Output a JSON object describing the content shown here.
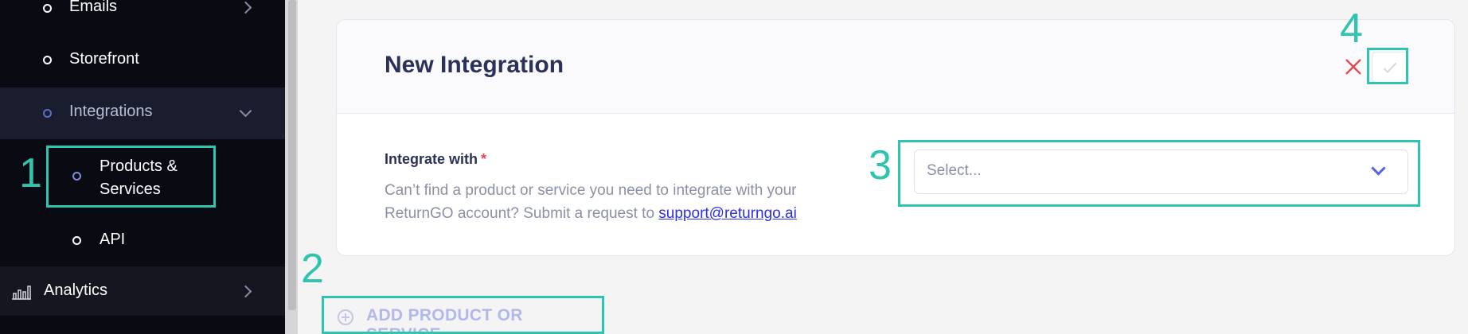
{
  "sidebar": {
    "items": [
      {
        "label": "Emails"
      },
      {
        "label": "Storefront"
      },
      {
        "label": "Integrations"
      },
      {
        "label": "Products & Services"
      },
      {
        "label": "API"
      },
      {
        "label": "Analytics"
      }
    ]
  },
  "card": {
    "title": "New Integration",
    "field_label": "Integrate with",
    "required_mark": "*",
    "help_text": "Can’t find a product or service you need to integrate with your ReturnGO account? Submit a request to ",
    "support_email": "support@returngo.ai",
    "select_placeholder": "Select..."
  },
  "add_button": {
    "label": "ADD PRODUCT OR SERVICE"
  },
  "annotations": [
    "1",
    "2",
    "3",
    "4"
  ],
  "colors": {
    "accent": "#2ec4ad",
    "title": "#2b3159",
    "close": "#e5484d",
    "link": "#2d2fe0",
    "sidebar_bg": "#0a0b12"
  }
}
